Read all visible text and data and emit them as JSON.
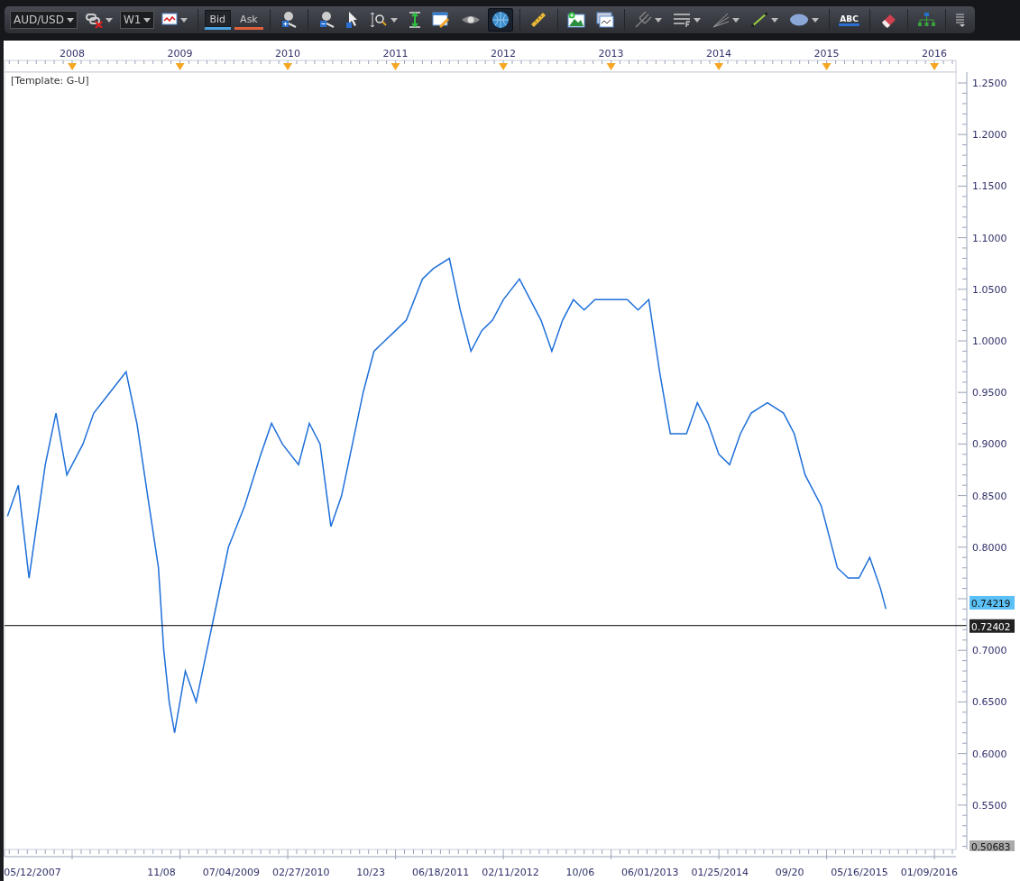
{
  "toolbar": {
    "symbol": "AUD/USD",
    "timeframe": "W1",
    "price_tabs": [
      {
        "label": "Bid",
        "selected": true,
        "color": "#4aa3e0"
      },
      {
        "label": "Ask",
        "selected": false,
        "color": "#e0603a"
      }
    ],
    "tools_left": [
      {
        "kind": "link",
        "dropdown": true
      }
    ],
    "tools_mid": [
      {
        "kind": "chart-type",
        "dropdown": true
      }
    ],
    "tools": [
      {
        "kind": "zoom-in",
        "dropdown": false,
        "selected": false
      },
      {
        "kind": "zoom-out",
        "dropdown": false,
        "selected": false
      },
      {
        "kind": "cursor",
        "dropdown": false,
        "selected": false
      },
      {
        "kind": "zoom-vertical",
        "dropdown": true,
        "selected": false
      },
      {
        "kind": "fit",
        "dropdown": false,
        "selected": false
      },
      {
        "kind": "edit",
        "dropdown": false,
        "selected": false
      },
      {
        "kind": "eye",
        "dropdown": false,
        "selected": false
      },
      {
        "kind": "globe",
        "dropdown": false,
        "selected": true
      },
      {
        "kind": "ruler",
        "dropdown": false,
        "selected": false
      },
      {
        "kind": "picture",
        "dropdown": false,
        "selected": false
      },
      {
        "kind": "window",
        "dropdown": false,
        "selected": false
      },
      {
        "kind": "pitchfork",
        "dropdown": true,
        "selected": false
      },
      {
        "kind": "lines",
        "dropdown": true,
        "selected": false
      },
      {
        "kind": "fan",
        "dropdown": true,
        "selected": false
      },
      {
        "kind": "line",
        "dropdown": true,
        "selected": false
      },
      {
        "kind": "ellipse",
        "dropdown": true,
        "selected": false
      },
      {
        "kind": "text",
        "label": "ABC",
        "dropdown": false,
        "selected": false
      },
      {
        "kind": "eraser",
        "dropdown": false,
        "selected": false
      },
      {
        "kind": "tree",
        "dropdown": false,
        "selected": false
      },
      {
        "kind": "overflow",
        "dropdown": false,
        "selected": false
      }
    ]
  },
  "chart": {
    "template_label": "[Template: G-U]",
    "current_price": "0.74219",
    "price_line": "0.72402",
    "axis_min": "0.50683",
    "date_labels": [
      "05/12/2007",
      "11/08",
      "07/04/2009",
      "02/27/2010",
      "10/23",
      "06/18/2011",
      "02/11/2012",
      "10/06",
      "06/01/2013",
      "01/25/2014",
      "09/20",
      "05/16/2015",
      "01/09/2016"
    ],
    "chart_data": {
      "type": "line",
      "x": [
        2007.4,
        2007.5,
        2007.6,
        2007.75,
        2007.85,
        2007.95,
        2008.1,
        2008.2,
        2008.35,
        2008.5,
        2008.6,
        2008.7,
        2008.8,
        2008.85,
        2008.9,
        2008.95,
        2009.05,
        2009.15,
        2009.25,
        2009.35,
        2009.45,
        2009.6,
        2009.75,
        2009.85,
        2009.95,
        2010.1,
        2010.2,
        2010.3,
        2010.4,
        2010.5,
        2010.6,
        2010.7,
        2010.8,
        2010.9,
        2011.0,
        2011.1,
        2011.25,
        2011.35,
        2011.5,
        2011.6,
        2011.7,
        2011.8,
        2011.9,
        2012.0,
        2012.15,
        2012.25,
        2012.35,
        2012.45,
        2012.55,
        2012.65,
        2012.75,
        2012.85,
        2013.0,
        2013.15,
        2013.25,
        2013.35,
        2013.45,
        2013.55,
        2013.7,
        2013.8,
        2013.9,
        2014.0,
        2014.1,
        2014.2,
        2014.3,
        2014.45,
        2014.6,
        2014.7,
        2014.8,
        2014.95,
        2015.0,
        2015.1,
        2015.2,
        2015.3,
        2015.4,
        2015.5,
        2015.55
      ],
      "series": [
        {
          "color": "#1e6fd9",
          "values": [
            0.83,
            0.86,
            0.77,
            0.88,
            0.93,
            0.87,
            0.9,
            0.93,
            0.95,
            0.97,
            0.92,
            0.85,
            0.78,
            0.7,
            0.65,
            0.62,
            0.68,
            0.65,
            0.7,
            0.75,
            0.8,
            0.84,
            0.89,
            0.92,
            0.9,
            0.88,
            0.92,
            0.9,
            0.82,
            0.85,
            0.9,
            0.95,
            0.99,
            1.0,
            1.01,
            1.02,
            1.06,
            1.07,
            1.08,
            1.03,
            0.99,
            1.01,
            1.02,
            1.04,
            1.06,
            1.04,
            1.02,
            0.99,
            1.02,
            1.04,
            1.03,
            1.04,
            1.04,
            1.04,
            1.03,
            1.04,
            0.97,
            0.91,
            0.91,
            0.94,
            0.92,
            0.89,
            0.88,
            0.91,
            0.93,
            0.94,
            0.93,
            0.91,
            0.87,
            0.84,
            0.82,
            0.78,
            0.77,
            0.77,
            0.79,
            0.76,
            0.74
          ]
        }
      ],
      "xlim": [
        2007.372,
        2016.2
      ],
      "ylim": [
        0.507,
        1.2605
      ],
      "ref_lines": [
        {
          "axis": "y",
          "value": 0.72402,
          "color": "#000000"
        }
      ],
      "xticks": [
        {
          "value": 2008,
          "label": "2008"
        },
        {
          "value": 2009,
          "label": "2009"
        },
        {
          "value": 2010,
          "label": "2010"
        },
        {
          "value": 2011,
          "label": "2011"
        },
        {
          "value": 2012,
          "label": "2012"
        },
        {
          "value": 2013,
          "label": "2013"
        },
        {
          "value": 2014,
          "label": "2014"
        },
        {
          "value": 2015,
          "label": "2015"
        },
        {
          "value": 2016,
          "label": "2016"
        }
      ],
      "yticks": [
        {
          "value": 1.25,
          "label": "1.2500"
        },
        {
          "value": 1.2,
          "label": "1.2000"
        },
        {
          "value": 1.15,
          "label": "1.1500"
        },
        {
          "value": 1.1,
          "label": "1.1000"
        },
        {
          "value": 1.05,
          "label": "1.0500"
        },
        {
          "value": 1.0,
          "label": "1.0000"
        },
        {
          "value": 0.95,
          "label": "0.9500"
        },
        {
          "value": 0.9,
          "label": "0.9000"
        },
        {
          "value": 0.85,
          "label": "0.8500"
        },
        {
          "value": 0.8,
          "label": "0.8000"
        },
        {
          "value": 0.7,
          "label": "0.7000"
        },
        {
          "value": 0.65,
          "label": "0.6500"
        },
        {
          "value": 0.6,
          "label": "0.6000"
        },
        {
          "value": 0.55,
          "label": "0.5500"
        }
      ]
    }
  }
}
